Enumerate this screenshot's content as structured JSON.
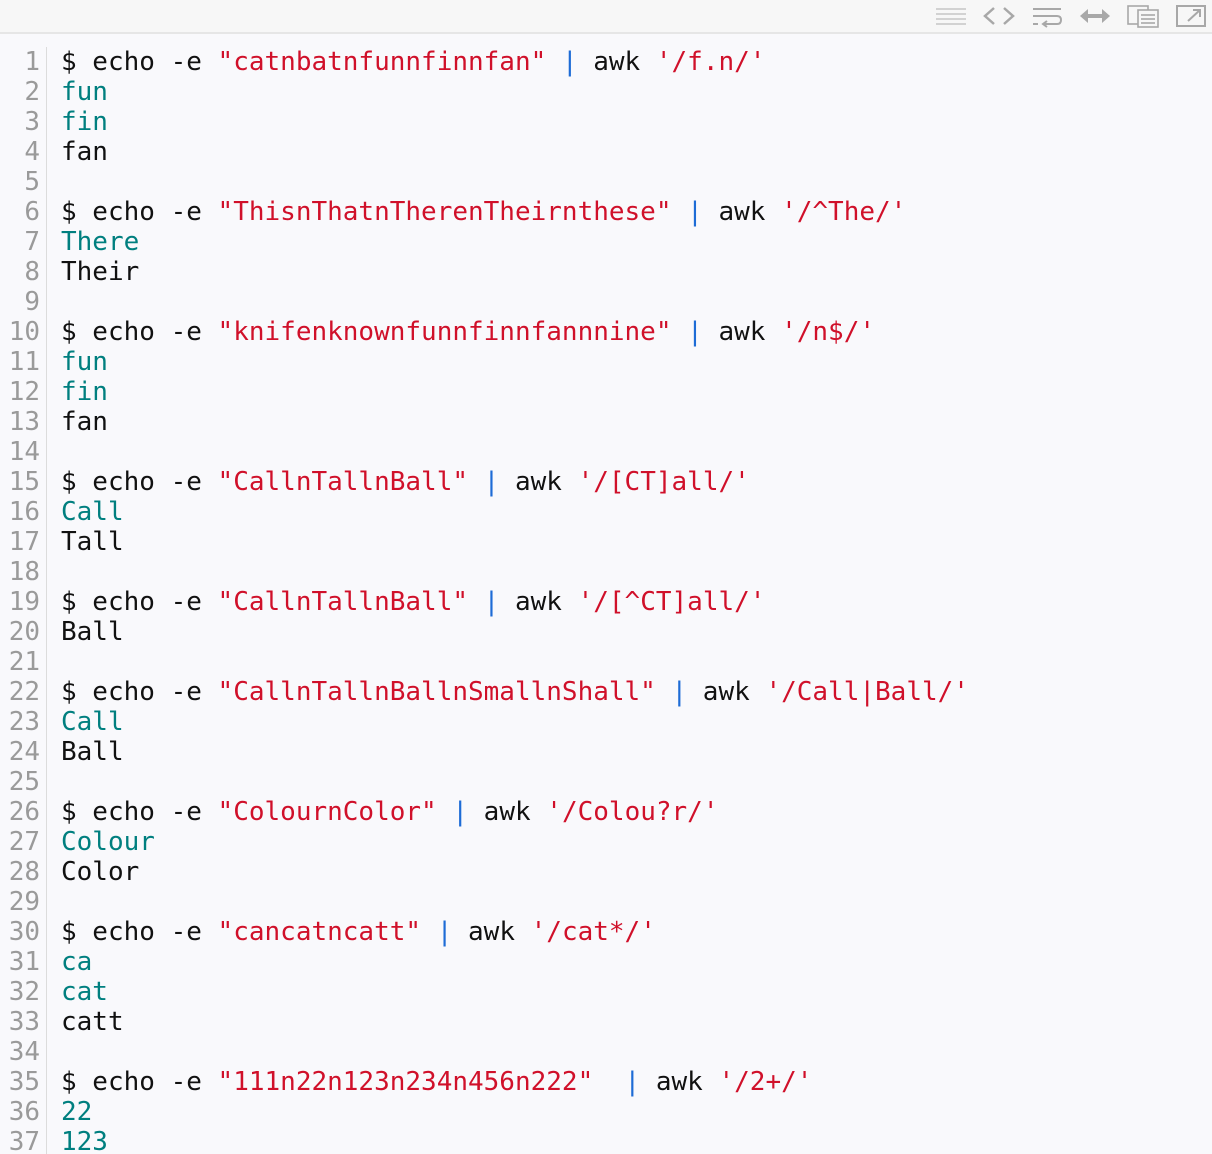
{
  "toolbar": {
    "icons": [
      "menu-icon",
      "code-icon",
      "wrap-icon",
      "expand-icon",
      "copy-icon",
      "popout-icon"
    ]
  },
  "colors": {
    "background": "#f9f9fc",
    "line_number": "#9a9a9a",
    "plain": "#111111",
    "string": "#d0102a",
    "output_highlight": "#007f7f",
    "pipe": "#1e6cd6"
  },
  "lines": [
    {
      "num": "1",
      "content": "$ echo -e \"catnbatnfunnfinnfan\" | awk '/f.n/'",
      "kind": "cmd"
    },
    {
      "num": "2",
      "content": "fun",
      "kind": "out"
    },
    {
      "num": "3",
      "content": "fin",
      "kind": "out"
    },
    {
      "num": "4",
      "content": "fan",
      "kind": "plain"
    },
    {
      "num": "5",
      "content": "",
      "kind": "plain"
    },
    {
      "num": "6",
      "content": "$ echo -e \"ThisnThatnTherenTheirnthese\" | awk '/^The/'",
      "kind": "cmd"
    },
    {
      "num": "7",
      "content": "There",
      "kind": "out"
    },
    {
      "num": "8",
      "content": "Their",
      "kind": "plain"
    },
    {
      "num": "9",
      "content": "",
      "kind": "plain"
    },
    {
      "num": "10",
      "content": "$ echo -e \"knifenknownfunnfinnfannnine\" | awk '/n$/'",
      "kind": "cmd"
    },
    {
      "num": "11",
      "content": "fun",
      "kind": "out"
    },
    {
      "num": "12",
      "content": "fin",
      "kind": "out"
    },
    {
      "num": "13",
      "content": "fan",
      "kind": "plain"
    },
    {
      "num": "14",
      "content": "",
      "kind": "plain"
    },
    {
      "num": "15",
      "content": "$ echo -e \"CallnTallnBall\" | awk '/[CT]all/'",
      "kind": "cmd"
    },
    {
      "num": "16",
      "content": "Call",
      "kind": "out"
    },
    {
      "num": "17",
      "content": "Tall",
      "kind": "plain"
    },
    {
      "num": "18",
      "content": "",
      "kind": "plain"
    },
    {
      "num": "19",
      "content": "$ echo -e \"CallnTallnBall\" | awk '/[^CT]all/'",
      "kind": "cmd"
    },
    {
      "num": "20",
      "content": "Ball",
      "kind": "plain"
    },
    {
      "num": "21",
      "content": "",
      "kind": "plain"
    },
    {
      "num": "22",
      "content": "$ echo -e \"CallnTallnBallnSmallnShall\" | awk '/Call|Ball/'",
      "kind": "cmd"
    },
    {
      "num": "23",
      "content": "Call",
      "kind": "out"
    },
    {
      "num": "24",
      "content": "Ball",
      "kind": "plain"
    },
    {
      "num": "25",
      "content": "",
      "kind": "plain"
    },
    {
      "num": "26",
      "content": "$ echo -e \"ColournColor\" | awk '/Colou?r/'",
      "kind": "cmd"
    },
    {
      "num": "27",
      "content": "Colour",
      "kind": "out"
    },
    {
      "num": "28",
      "content": "Color",
      "kind": "plain"
    },
    {
      "num": "29",
      "content": "",
      "kind": "plain"
    },
    {
      "num": "30",
      "content": "$ echo -e \"cancatncatt\" | awk '/cat*/'",
      "kind": "cmd"
    },
    {
      "num": "31",
      "content": "ca",
      "kind": "out"
    },
    {
      "num": "32",
      "content": "cat",
      "kind": "out"
    },
    {
      "num": "33",
      "content": "catt",
      "kind": "plain"
    },
    {
      "num": "34",
      "content": "",
      "kind": "plain"
    },
    {
      "num": "35",
      "content": "$ echo -e \"111n22n123n234n456n222\"  | awk '/2+/'",
      "kind": "cmd"
    },
    {
      "num": "36",
      "content": "22",
      "kind": "out"
    },
    {
      "num": "37",
      "content": "123",
      "kind": "out"
    }
  ]
}
